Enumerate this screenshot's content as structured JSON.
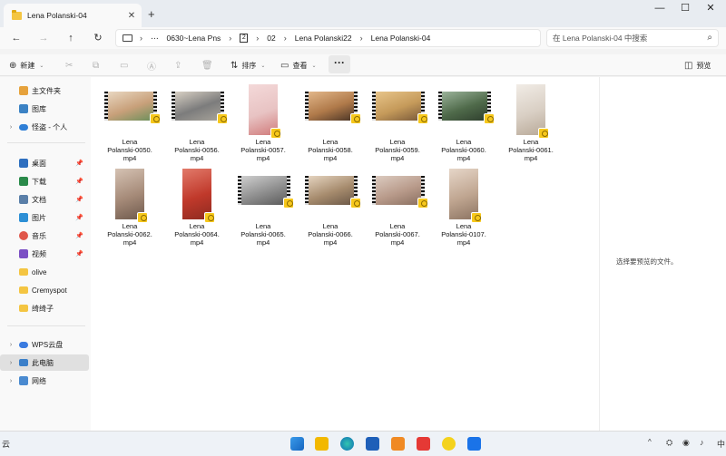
{
  "window": {
    "tab_title": "Lena Polanski-04",
    "new_tab_label": "+",
    "minimize": "—",
    "maximize": "☐",
    "close": "✕"
  },
  "nav": {
    "back": "←",
    "forward": "→",
    "up": "↑",
    "refresh": "↻",
    "breadcrumb": [
      "0630~Lena Pns",
      "2",
      "02",
      "Lena Polanski22",
      "Lena Polanski-04"
    ],
    "overflow": "⋯",
    "search_placeholder": "在 Lena Polanski-04 中搜索"
  },
  "toolbar": {
    "new_label": "新建",
    "sort_label": "排序",
    "view_label": "查看",
    "more_label": "···",
    "preview_label": "预览"
  },
  "sidebar": {
    "items": [
      {
        "label": "主文件夹",
        "icon": "home-icon"
      },
      {
        "label": "图库",
        "icon": "gallery-icon"
      },
      {
        "label": "怪盗 - 个人",
        "icon": "onedrive-icon"
      },
      {
        "label": "桌面",
        "icon": "desktop-icon"
      },
      {
        "label": "下载",
        "icon": "download-icon"
      },
      {
        "label": "文档",
        "icon": "documents-icon"
      },
      {
        "label": "图片",
        "icon": "pictures-icon"
      },
      {
        "label": "音乐",
        "icon": "music-icon"
      },
      {
        "label": "视频",
        "icon": "videos-icon"
      },
      {
        "label": "olive",
        "icon": "folder-icon"
      },
      {
        "label": "Cremyspot",
        "icon": "folder-icon"
      },
      {
        "label": "绮绮子",
        "icon": "folder-icon"
      },
      {
        "label": "WPS云盘",
        "icon": "wps-cloud-icon"
      },
      {
        "label": "此电脑",
        "icon": "this-pc-icon"
      },
      {
        "label": "网络",
        "icon": "network-icon"
      }
    ]
  },
  "files": [
    {
      "line1": "Lena",
      "line2": "Polanski-0050.",
      "line3": "mp4",
      "orient": "land"
    },
    {
      "line1": "Lena",
      "line2": "Polanski-0056.",
      "line3": "mp4",
      "orient": "land"
    },
    {
      "line1": "Lena",
      "line2": "Polanski-0057.",
      "line3": "mp4",
      "orient": "port"
    },
    {
      "line1": "Lena",
      "line2": "Polanski-0058.",
      "line3": "mp4",
      "orient": "land"
    },
    {
      "line1": "Lena",
      "line2": "Polanski-0059.",
      "line3": "mp4",
      "orient": "land"
    },
    {
      "line1": "Lena",
      "line2": "Polanski-0060.",
      "line3": "mp4",
      "orient": "land"
    },
    {
      "line1": "Lena",
      "line2": "Polanski-0061.",
      "line3": "mp4",
      "orient": "port"
    },
    {
      "line1": "Lena",
      "line2": "Polanski-0062.",
      "line3": "mp4",
      "orient": "port"
    },
    {
      "line1": "Lena",
      "line2": "Polanski-0064.",
      "line3": "mp4",
      "orient": "port"
    },
    {
      "line1": "Lena",
      "line2": "Polanski-0065.",
      "line3": "mp4",
      "orient": "land"
    },
    {
      "line1": "Lena",
      "line2": "Polanski-0066.",
      "line3": "mp4",
      "orient": "land"
    },
    {
      "line1": "Lena",
      "line2": "Polanski-0067.",
      "line3": "mp4",
      "orient": "land"
    },
    {
      "line1": "Lena",
      "line2": "Polanski-0107.",
      "line3": "mp4",
      "orient": "port"
    }
  ],
  "preview_pane": {
    "message": "选择要预览的文件。"
  },
  "taskbar": {
    "left_text": "云",
    "right_text": "中"
  },
  "colors": {
    "accent": "#0067c0",
    "folder": "#f4c542",
    "badge": "#f7c81c"
  }
}
